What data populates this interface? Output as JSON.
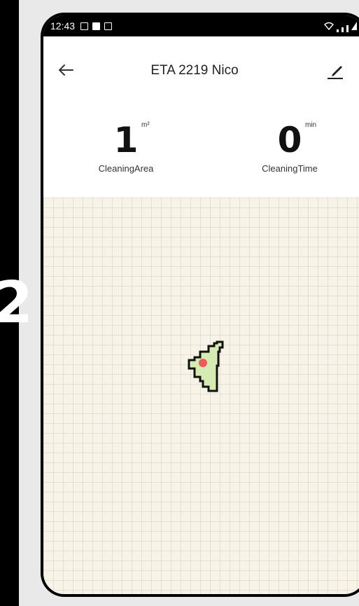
{
  "side": {
    "digit": "2"
  },
  "status_bar": {
    "time": "12:43"
  },
  "header": {
    "title": "ETA 2219 Nico"
  },
  "stats": {
    "area": {
      "value": "1",
      "unit": "m²",
      "label": "CleaningArea"
    },
    "time": {
      "value": "0",
      "unit": "min",
      "label": "CleaningTime"
    }
  },
  "colors": {
    "cleaned_area": "#d5ebb3",
    "robot": "#ef5b57",
    "map_bg": "#f7f3e8"
  }
}
